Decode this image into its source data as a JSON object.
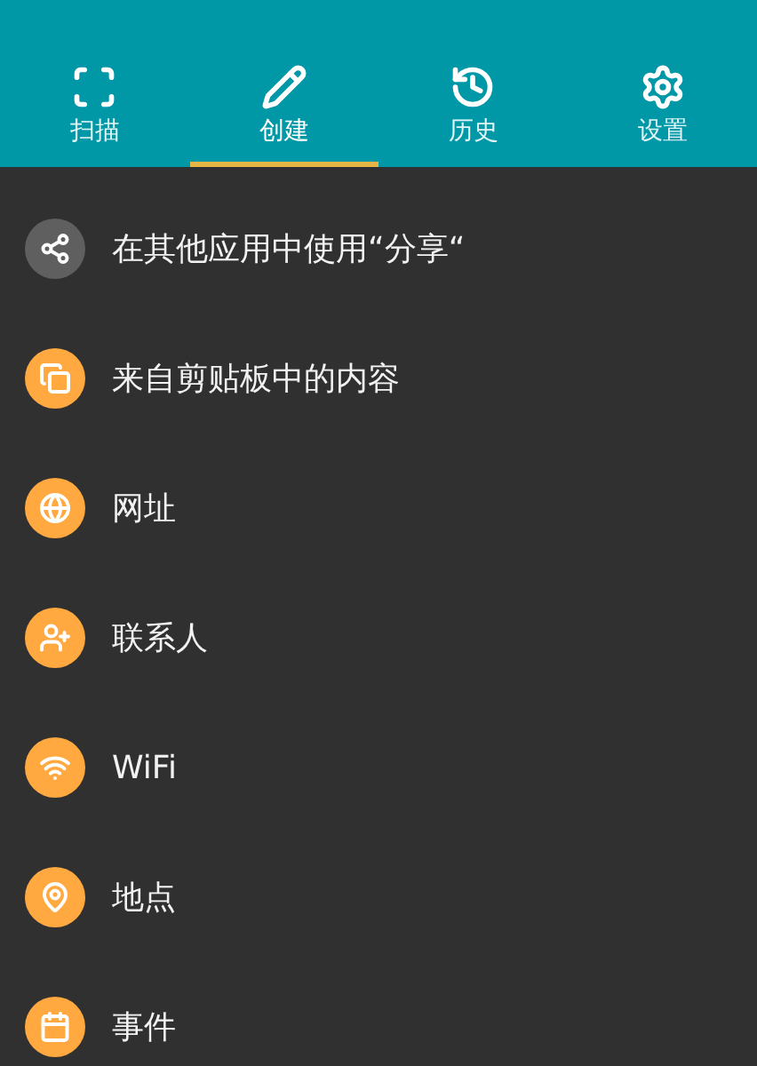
{
  "tabs": [
    {
      "label": "扫描",
      "selected": false
    },
    {
      "label": "创建",
      "selected": true
    },
    {
      "label": "历史",
      "selected": false
    },
    {
      "label": "设置",
      "selected": false
    }
  ],
  "items": [
    {
      "label": "在其他应用中使用“分享“",
      "color": "#5f5f5f"
    },
    {
      "label": "来自剪贴板中的内容",
      "color": "#ffa940"
    },
    {
      "label": "网址",
      "color": "#ffa940"
    },
    {
      "label": "联系人",
      "color": "#ffa940"
    },
    {
      "label": "WiFi",
      "color": "#ffa940"
    },
    {
      "label": "地点",
      "color": "#ffa940"
    },
    {
      "label": "事件",
      "color": "#ffa940"
    }
  ]
}
